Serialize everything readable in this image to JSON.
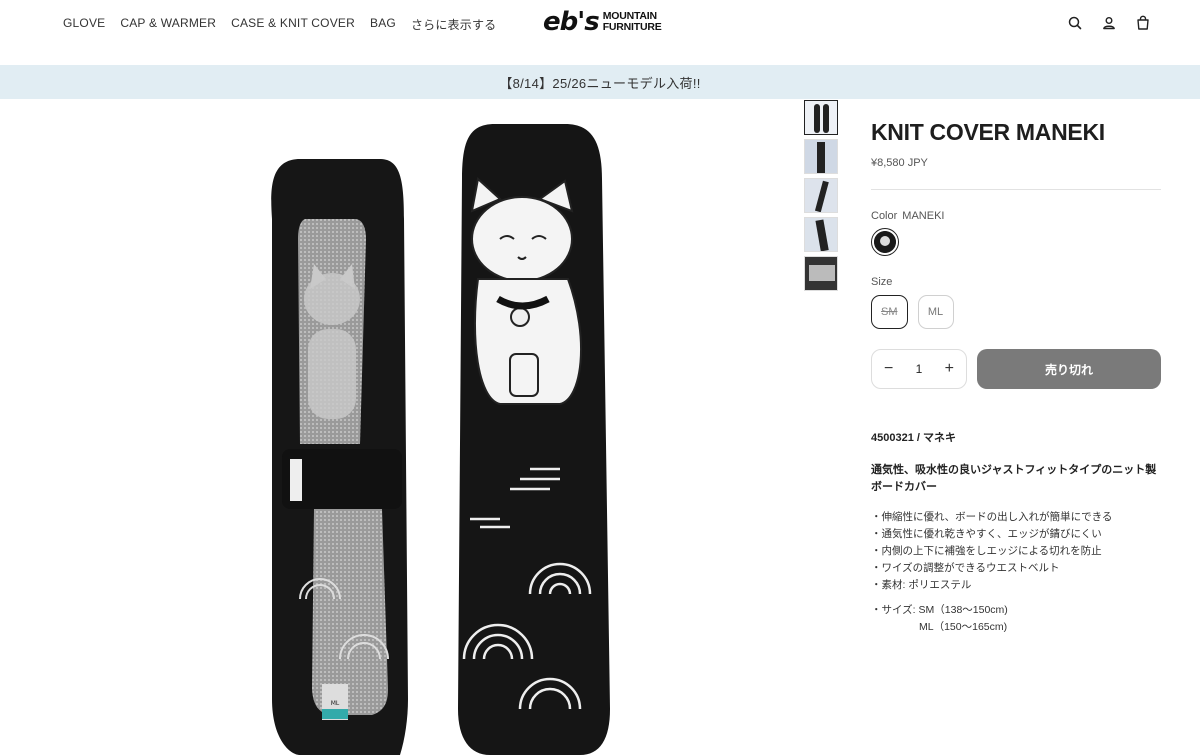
{
  "header": {
    "nav": [
      "GLOVE",
      "CAP & WARMER",
      "CASE & KNIT COVER",
      "BAG",
      "さらに表示する"
    ],
    "logo_mark": "eb's",
    "logo_line1": "MOUNTAIN",
    "logo_line2": "FURNITURE",
    "icons": [
      "search-icon",
      "account-icon",
      "cart-icon"
    ]
  },
  "announcement": "【8/14】25/26ニューモデル入荷!!",
  "product": {
    "title": "KNIT COVER MANEKI",
    "price": "¥8,580 JPY",
    "color_label": "Color",
    "color_value": "MANEKI",
    "size_label": "Size",
    "sizes": [
      "SM",
      "ML"
    ],
    "quantity": "1",
    "sold_out_label": "売り切れ",
    "code": "4500321 / マネキ",
    "lead": "通気性、吸水性の良いジャストフィットタイプのニット製ボードカバー",
    "features": [
      "伸縮性に優れ、ボードの出し入れが簡単にできる",
      "通気性に優れ乾きやすく、エッジが錆びにくい",
      "内側の上下に補強をしエッジによる切れを防止",
      "ワイズの調整ができるウエストベルト",
      "素材: ポリエステル"
    ],
    "spec_line1": "・サイズ: SM（138〜150cm)",
    "spec_line2": "ML（150〜165cm)",
    "tag_size": "ML"
  },
  "colors": {
    "announce_bg": "#e1edf3",
    "sold_out_bg": "#7a7a7a"
  }
}
